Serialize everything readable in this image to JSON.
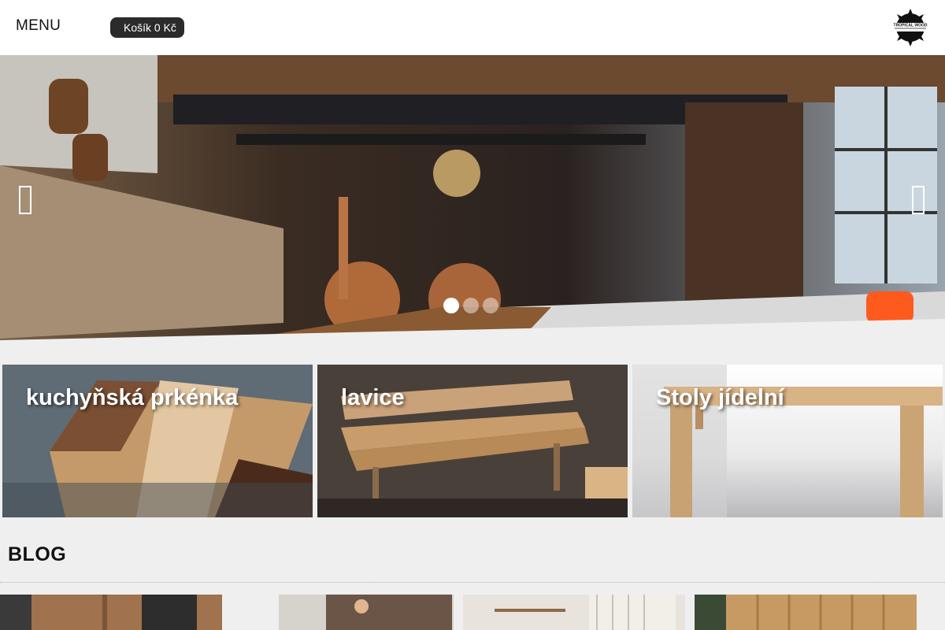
{
  "header": {
    "menu_label": "MENU",
    "cart_label": "Košík 0 Kč",
    "logo_icon": "tropical-wood-saw-blade-logo"
  },
  "hero": {
    "prev_icon": "chevron-left-icon",
    "next_icon": "chevron-right-icon",
    "slides_count": 3,
    "active_slide": 1
  },
  "categories": [
    {
      "title": "kuchyňská prkénka"
    },
    {
      "title": "lavice"
    },
    {
      "title": "Stoly jídelní"
    }
  ],
  "blog": {
    "title": "BLOG"
  },
  "colors": {
    "header_bg": "#ffffff",
    "cart_bg": "#2b2b2b",
    "page_bg": "#efefef"
  }
}
